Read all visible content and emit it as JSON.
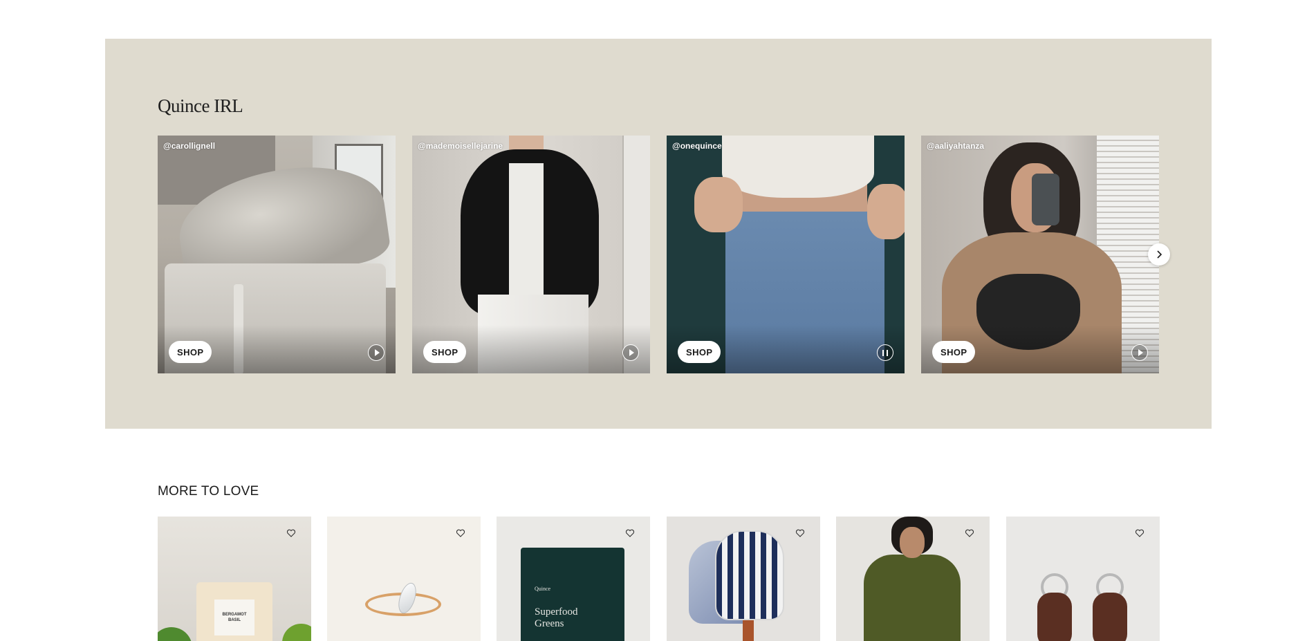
{
  "irl_section": {
    "title": "Quince IRL",
    "cards": [
      {
        "handle": "@carollignell",
        "shop_label": "SHOP",
        "media_state": "play"
      },
      {
        "handle": "@mademoisellejarine",
        "shop_label": "SHOP",
        "media_state": "play"
      },
      {
        "handle": "@onequince",
        "shop_label": "SHOP",
        "media_state": "pause"
      },
      {
        "handle": "@aaliyahtanza",
        "shop_label": "SHOP",
        "media_state": "play"
      }
    ],
    "next_icon": "chevron-right-icon"
  },
  "more_to_love": {
    "title": "MORE TO LOVE",
    "products": [
      {
        "image": "candle",
        "label_line1": "BERGAMOT",
        "label_line2": "BASIL",
        "favorite_icon": "heart-icon"
      },
      {
        "image": "ring",
        "favorite_icon": "heart-icon"
      },
      {
        "image": "superfood-greens-bag",
        "brand": "Quince",
        "name_line1": "Superfood",
        "name_line2": "Greens",
        "favorite_icon": "heart-icon"
      },
      {
        "image": "pickleball-paddles",
        "favorite_icon": "heart-icon"
      },
      {
        "image": "poncho",
        "favorite_icon": "heart-icon"
      },
      {
        "image": "airtag-keychains",
        "favorite_icon": "heart-icon"
      }
    ]
  },
  "colors": {
    "irl_background": "#dfdbcf",
    "page_background": "#ffffff"
  }
}
